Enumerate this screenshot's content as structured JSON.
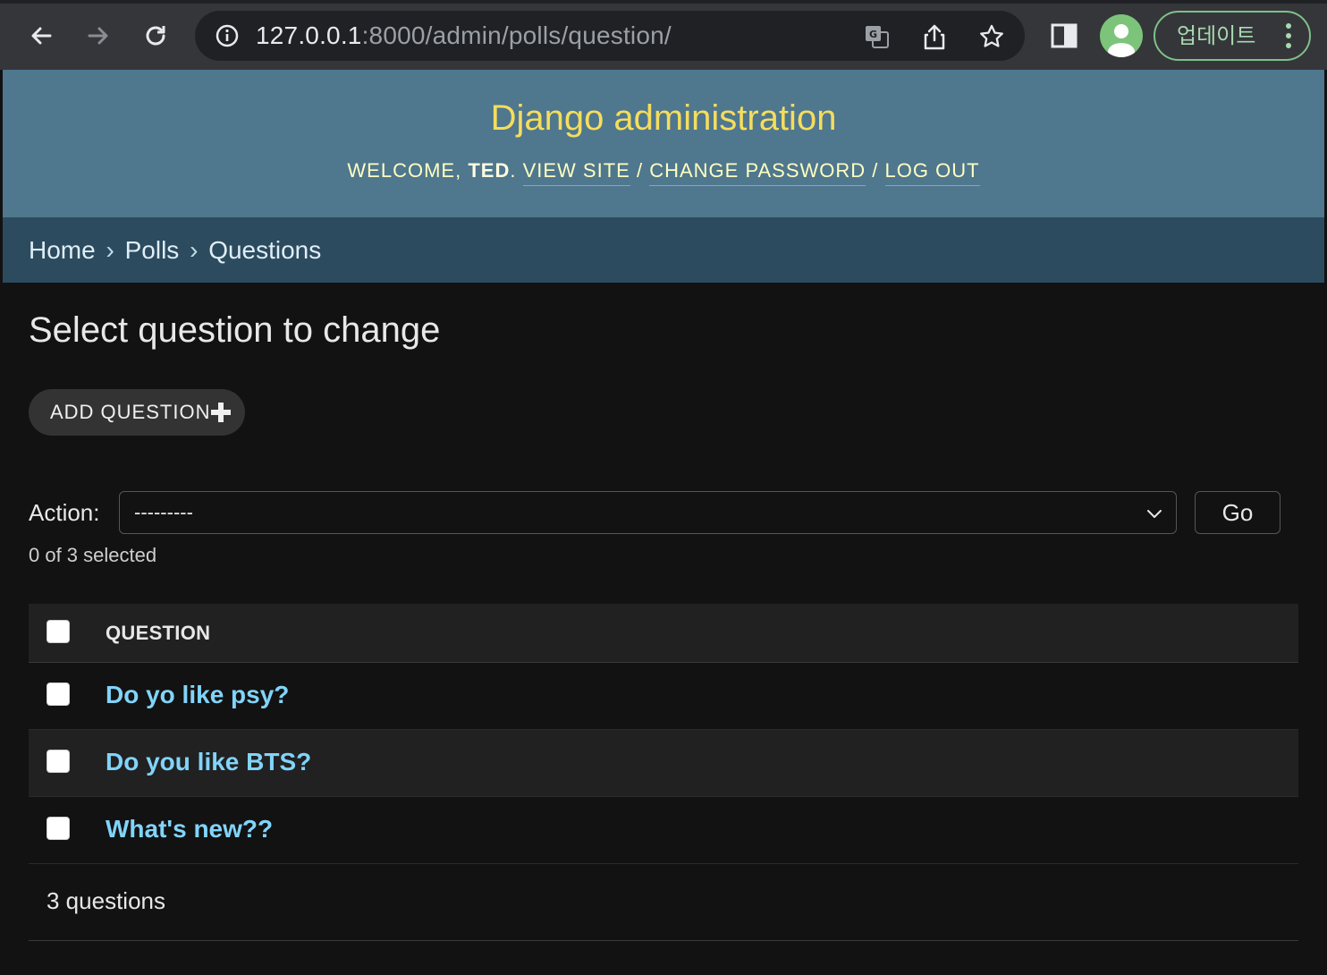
{
  "browser": {
    "url_host": "127.0.0.1",
    "url_rest": ":8000/admin/polls/question/",
    "update_label": "업데이트",
    "icons": [
      "back-arrow-icon",
      "forward-arrow-icon",
      "reload-icon",
      "info-icon",
      "translate-icon",
      "share-icon",
      "star-icon",
      "side-panel-icon",
      "profile-avatar",
      "more-vert-icon"
    ]
  },
  "header": {
    "site_title": "Django administration",
    "welcome": "Welcome,",
    "username": "Ted",
    "view_site": "View site",
    "change_password": "Change password",
    "log_out": "Log out",
    "separator": "/"
  },
  "breadcrumbs": {
    "home": "Home",
    "app": "Polls",
    "current": "Questions",
    "arrow": "›"
  },
  "content": {
    "title": "Select question to change",
    "add_button": "Add question",
    "action_label": "Action:",
    "action_selected": "---------",
    "go_button": "Go",
    "selected_count": "0 of 3 selected",
    "column_header": "Question",
    "rows": [
      {
        "text": "Do yo like psy?"
      },
      {
        "text": "Do you like BTS?"
      },
      {
        "text": "What's new??"
      }
    ],
    "paginator": "3 questions"
  },
  "colors": {
    "header_bg": "#4f778e",
    "breadcrumb_bg": "#2c4b5f",
    "title_yellow": "#f5dd5d",
    "link_blue": "#81d4fa",
    "page_bg": "#121212"
  }
}
